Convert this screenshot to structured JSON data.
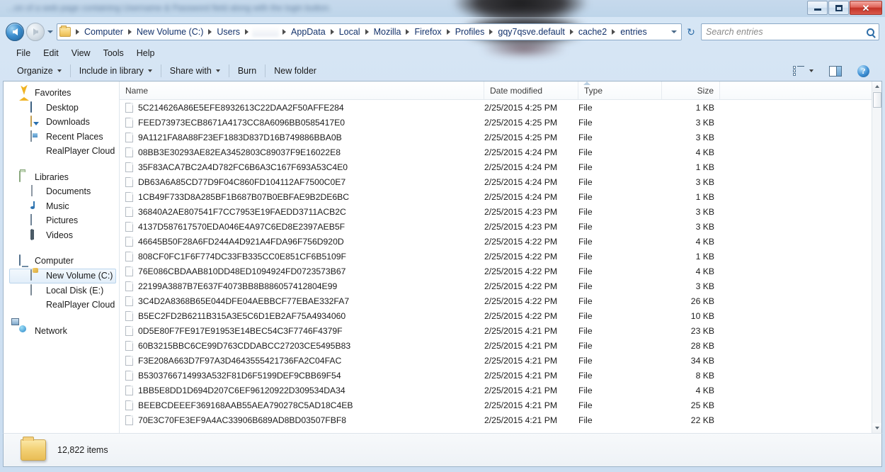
{
  "window": {
    "banner_text": "...on of a web page containing Username & Password field along with the login button.",
    "minimize_label": "Minimize",
    "maximize_label": "Maximize",
    "close_label": "Close",
    "close_glyph": "✕"
  },
  "address": {
    "back_label": "Back",
    "forward_label": "Forward",
    "history_label": "Recent pages",
    "breadcrumbs": [
      {
        "label": "Computer",
        "redacted": false
      },
      {
        "label": "New Volume (C:)",
        "redacted": false
      },
      {
        "label": "Users",
        "redacted": false
      },
      {
        "label": "",
        "redacted": true
      },
      {
        "label": "AppData",
        "redacted": false
      },
      {
        "label": "Local",
        "redacted": false
      },
      {
        "label": "Mozilla",
        "redacted": false
      },
      {
        "label": "Firefox",
        "redacted": false
      },
      {
        "label": "Profiles",
        "redacted": false
      },
      {
        "label": "gqy7qsve.default",
        "redacted": false
      },
      {
        "label": "cache2",
        "redacted": false
      },
      {
        "label": "entries",
        "redacted": false
      }
    ],
    "refresh_glyph": "↻",
    "refresh_label": "Refresh",
    "search_placeholder": "Search entries",
    "search_value": ""
  },
  "menubar": {
    "items": [
      "File",
      "Edit",
      "View",
      "Tools",
      "Help"
    ]
  },
  "toolbar": {
    "items": [
      {
        "label": "Organize",
        "caret": true
      },
      {
        "label": "Include in library",
        "caret": true
      },
      {
        "label": "Share with",
        "caret": true
      },
      {
        "label": "Burn",
        "caret": false
      },
      {
        "label": "New folder",
        "caret": false
      }
    ],
    "view_label": "Change your view",
    "preview_label": "Show the preview pane",
    "help_label": "Get help",
    "help_glyph": "?"
  },
  "sidebar": {
    "groups": [
      {
        "header": {
          "label": "Favorites",
          "icon": "star-icon"
        },
        "items": [
          {
            "label": "Desktop",
            "icon": "monitor-icon",
            "selected": false
          },
          {
            "label": "Downloads",
            "icon": "download-icon",
            "selected": false
          },
          {
            "label": "Recent Places",
            "icon": "recent-places-icon",
            "selected": false
          },
          {
            "label": "RealPlayer Cloud",
            "icon": "cloud-icon",
            "selected": false
          }
        ]
      },
      {
        "header": {
          "label": "Libraries",
          "icon": "libraries-icon"
        },
        "items": [
          {
            "label": "Documents",
            "icon": "document-icon",
            "selected": false
          },
          {
            "label": "Music",
            "icon": "music-note-icon",
            "selected": false
          },
          {
            "label": "Pictures",
            "icon": "picture-icon",
            "selected": false
          },
          {
            "label": "Videos",
            "icon": "video-icon",
            "selected": false
          }
        ]
      },
      {
        "header": {
          "label": "Computer",
          "icon": "computer-icon"
        },
        "items": [
          {
            "label": "New Volume (C:)",
            "icon": "windows-drive-icon",
            "selected": true
          },
          {
            "label": "Local Disk (E:)",
            "icon": "drive-icon",
            "selected": false
          },
          {
            "label": "RealPlayer Cloud",
            "icon": "cloud-icon",
            "selected": false
          }
        ]
      },
      {
        "header": {
          "label": "Network",
          "icon": "network-icon"
        },
        "items": []
      }
    ]
  },
  "filelist": {
    "columns": [
      "Name",
      "Date modified",
      "Type",
      "Size"
    ],
    "sorted_column": "Date modified",
    "sort_direction": "ascending",
    "rows": [
      {
        "name": "5C214626A86E5EFE8932613C22DAA2F50AFFE284",
        "date": "2/25/2015 4:25 PM",
        "type": "File",
        "size": "1 KB"
      },
      {
        "name": "FEED73973ECB8671A4173CC8A6096BB0585417E0",
        "date": "2/25/2015 4:25 PM",
        "type": "File",
        "size": "3 KB"
      },
      {
        "name": "9A1121FA8A88F23EF1883D837D16B749886BBA0B",
        "date": "2/25/2015 4:25 PM",
        "type": "File",
        "size": "3 KB"
      },
      {
        "name": "08BB3E30293AE82EA3452803C89037F9E16022E8",
        "date": "2/25/2015 4:24 PM",
        "type": "File",
        "size": "4 KB"
      },
      {
        "name": "35F83ACA7BC2A4D782FC6B6A3C167F693A53C4E0",
        "date": "2/25/2015 4:24 PM",
        "type": "File",
        "size": "1 KB"
      },
      {
        "name": "DB63A6A85CD77D9F04C860FD104112AF7500C0E7",
        "date": "2/25/2015 4:24 PM",
        "type": "File",
        "size": "3 KB"
      },
      {
        "name": "1CB49F733D8A285BF1B687B07B0EBFAE9B2DE6BC",
        "date": "2/25/2015 4:24 PM",
        "type": "File",
        "size": "1 KB"
      },
      {
        "name": "36840A2AE807541F7CC7953E19FAEDD3711ACB2C",
        "date": "2/25/2015 4:23 PM",
        "type": "File",
        "size": "3 KB"
      },
      {
        "name": "4137D587617570EDA046E4A97C6ED8E2397AEB5F",
        "date": "2/25/2015 4:23 PM",
        "type": "File",
        "size": "3 KB"
      },
      {
        "name": "46645B50F28A6FD244A4D921A4FDA96F756D920D",
        "date": "2/25/2015 4:22 PM",
        "type": "File",
        "size": "4 KB"
      },
      {
        "name": "808CF0FC1F6F774DC33FB335CC0E851CF6B5109F",
        "date": "2/25/2015 4:22 PM",
        "type": "File",
        "size": "1 KB"
      },
      {
        "name": "76E086CBDAAB810DD48ED1094924FD0723573B67",
        "date": "2/25/2015 4:22 PM",
        "type": "File",
        "size": "4 KB"
      },
      {
        "name": "22199A3887B7E637F4073BB8B886057412804E99",
        "date": "2/25/2015 4:22 PM",
        "type": "File",
        "size": "3 KB"
      },
      {
        "name": "3C4D2A8368B65E044DFE04AEBBCF77EBAE332FA7",
        "date": "2/25/2015 4:22 PM",
        "type": "File",
        "size": "26 KB"
      },
      {
        "name": "B5EC2FD2B6211B315A3E5C6D1EB2AF75A4934060",
        "date": "2/25/2015 4:22 PM",
        "type": "File",
        "size": "10 KB"
      },
      {
        "name": "0D5E80F7FE917E91953E14BEC54C3F7746F4379F",
        "date": "2/25/2015 4:21 PM",
        "type": "File",
        "size": "23 KB"
      },
      {
        "name": "60B3215BBC6CE99D763CDDABCC27203CE5495B83",
        "date": "2/25/2015 4:21 PM",
        "type": "File",
        "size": "28 KB"
      },
      {
        "name": "F3E208A663D7F97A3D4643555421736FA2C04FAC",
        "date": "2/25/2015 4:21 PM",
        "type": "File",
        "size": "34 KB"
      },
      {
        "name": "B5303766714993A532F81D6F5199DEF9CBB69F54",
        "date": "2/25/2015 4:21 PM",
        "type": "File",
        "size": "8 KB"
      },
      {
        "name": "1BB5E8DD1D694D207C6EF96120922D309534DA34",
        "date": "2/25/2015 4:21 PM",
        "type": "File",
        "size": "4 KB"
      },
      {
        "name": "BEEBCDEEEF369168AAB55AEA790278C5AD18C4EB",
        "date": "2/25/2015 4:21 PM",
        "type": "File",
        "size": "25 KB"
      },
      {
        "name": "70E3C70FE3EF9A4AC33906B689AD8BD03507FBF8",
        "date": "2/25/2015 4:21 PM",
        "type": "File",
        "size": "22 KB"
      }
    ]
  },
  "statusbar": {
    "item_count": "12,822 items"
  }
}
